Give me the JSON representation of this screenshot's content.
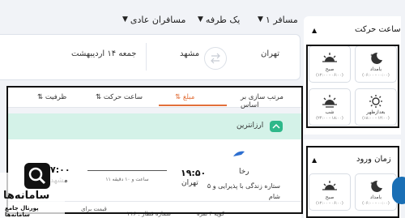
{
  "filters": {
    "passengers": "۱ مسافر",
    "trip_type": "یک طرفه",
    "cabin": "مسافران عادی"
  },
  "search": {
    "origin": "تهران",
    "destination": "مشهد",
    "date": "جمعه ۱۴ اردیبهشت"
  },
  "sidebar": {
    "departure_title": "ساعت حرکت",
    "arrival_title": "زمان ورود",
    "departure_tiles": [
      {
        "label": "بامداد",
        "range": "(۰۶:۰۰ - ۰۰:۰۰)",
        "icon": "moon-icon"
      },
      {
        "label": "صبح",
        "range": "(۱۲:۰۰ - ۰۶:۰۰)",
        "icon": "sunrise-icon"
      },
      {
        "label": "بعدازظهر",
        "range": "(۱۸:۰۰ - ۱۲:۰۰)",
        "icon": "sun-icon"
      },
      {
        "label": "شب",
        "range": "(۲۴:۰۰ - ۱۸:۰۰)",
        "icon": "sunset-icon"
      }
    ],
    "arrival_tiles": [
      {
        "label": "بامداد",
        "range": "(۰۶:۰۰ - ۰۰:۰۰)",
        "icon": "moon-icon"
      },
      {
        "label": "صبح",
        "range": "(۱۲:۰۰ - ۰۶:۰۰)",
        "icon": "sunrise-icon"
      }
    ]
  },
  "sort": {
    "label": "مرتب سازی بر اساس",
    "options": [
      "مبلغ",
      "ساعت حرکت",
      "ظرفیت"
    ],
    "active": "مبلغ"
  },
  "airline_strip": {
    "label": "ارزانترین"
  },
  "flight": {
    "airline": "رخا",
    "hotel": "۵ ستاره زندگی با پذیرایی و شام",
    "depart_time": "۱۹:۵۰",
    "depart_city": "تهران",
    "duration": "۱۱ ساعت و ۱۰ دقیقه",
    "arrive_time": "۷:۰۰",
    "arrive_city": "مشهد",
    "price_label": "قیمت برای",
    "train_no": "شماره قطار : ۲۱۶",
    "coach": "کوپه ۴ نفره"
  },
  "logo": {
    "text": "سامانه‌ها",
    "subtext": "پورتال جامع سامانه‌ها"
  },
  "colors": {
    "accent": "#e2703a",
    "strip": "#d4f2e8",
    "brand": "#1a6fb5"
  }
}
